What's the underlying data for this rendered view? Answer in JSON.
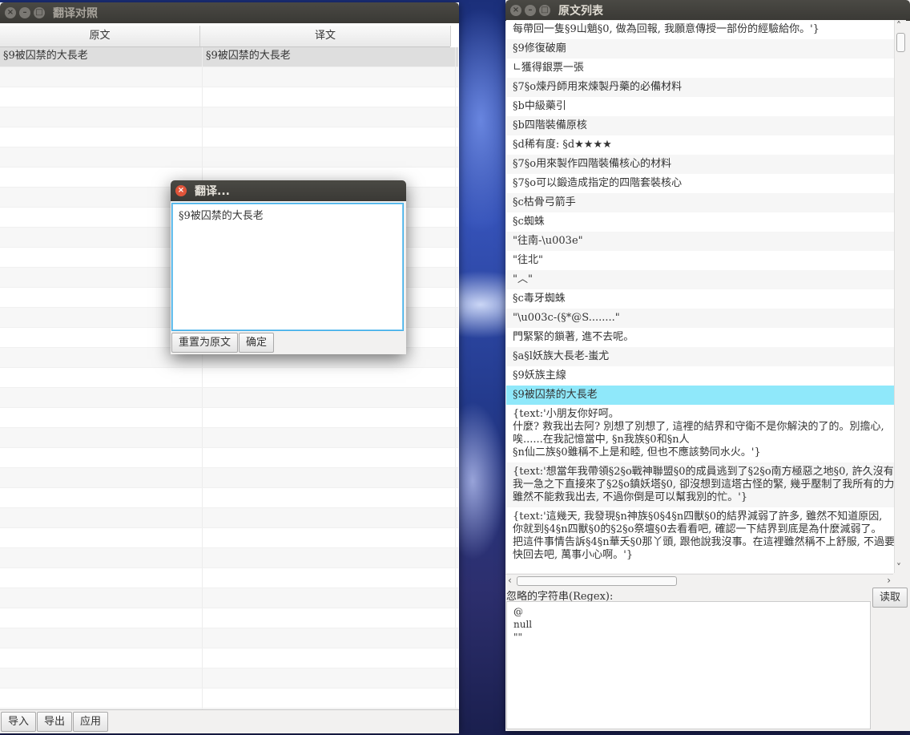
{
  "left_window": {
    "title": "翻译对照",
    "columns": [
      "原文",
      "译文"
    ],
    "rows": [
      {
        "original": "§9被囚禁的大長老",
        "translation": "§9被囚禁的大長老",
        "selected": true
      }
    ],
    "footer_buttons": [
      "导入",
      "导出",
      "应用"
    ]
  },
  "dialog": {
    "title": "翻译...",
    "text": "§9被囚禁的大長老",
    "reset_label": "重置为原文",
    "ok_label": "确定"
  },
  "right_window": {
    "title": "原文列表",
    "items": [
      "每帶回一隻§9山魈§0, 做為回報, 我願意傳授一部份的經驗給你。'}",
      "§9修復破廟",
      " ∟獲得銀票一張",
      "§7§o煉丹師用來煉製丹藥的必備材料",
      "§b中級藥引",
      "§b四階裝備原核",
      "§d稀有度: §d★★★★",
      "§7§o用來製作四階裝備核心的材料",
      "§7§o可以鍛造成指定的四階套裝核心",
      "§c枯骨弓箭手",
      "§c蜘蛛",
      "\"往南-\\u003e\"",
      "\"往北\"",
      "\"︿\"",
      "§c毒牙蜘蛛",
      "\"\\u003c-(§*@S........\"",
      "門緊緊的鎖著, 進不去呢。",
      "§a§l妖族大長老-蚩尤",
      "§9妖族主線",
      "§9被囚禁的大長老"
    ],
    "selected_index": 19,
    "multiline_items": [
      "{text:'小朋友你好呵。\n什麼? 救我出去阿? 別想了別想了, 這裡的結界和守衛不是你解決的了的。別擔心,\n唉......在我記憶當中, §n我族§0和§n人\n§n仙二族§0雖稱不上是和睦, 但也不應該勢同水火。'}",
      "{text:'想當年我帶領§2§o戰神聯盟§0的成員逃到了§2§o南方極惡之地§0, 許久沒有\n我一急之下直接來了§2§o鎮妖塔§0, 卻沒想到這塔古怪的緊, 幾乎壓制了我所有的力\n雖然不能救我出去, 不過你倒是可以幫我別的忙。'}",
      "{text:'這幾天, 我發現§n神族§0§4§n四獸§0的結界減弱了許多, 雖然不知道原因,\n你就到§4§n四獸§0的§2§o祭壇§0去看看吧, 確認一下結界到底是為什麼減弱了。\n把這件事情告訴§4§n華夭§0那丫頭, 跟他說我沒事。在這裡雖然稱不上舒服, 不過要\n快回去吧, 萬事小心啊。'}"
    ],
    "regex_label": "忽略的字符串(Regex):",
    "regex_lines": [
      "@",
      "null",
      "\"\""
    ],
    "read_button": "读取"
  }
}
